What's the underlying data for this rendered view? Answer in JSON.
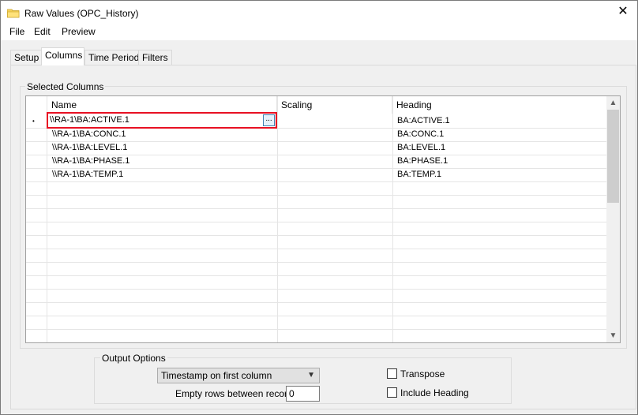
{
  "window": {
    "title": "Raw Values (OPC_History)"
  },
  "menu": {
    "items": [
      "File",
      "Edit",
      "Preview"
    ]
  },
  "tabs": [
    {
      "label": "Setup",
      "active": false
    },
    {
      "label": "Columns",
      "active": true
    },
    {
      "label": "Time Period",
      "active": false
    },
    {
      "label": "Filters",
      "active": false
    }
  ],
  "selected_columns": {
    "group_label": "Selected Columns",
    "headers": {
      "name": "Name",
      "scaling": "Scaling",
      "heading": "Heading"
    },
    "rows": [
      {
        "name": "\\\\RA-1\\BA:ACTIVE.1",
        "scaling": "",
        "heading": "BA:ACTIVE.1"
      },
      {
        "name": "\\\\RA-1\\BA:CONC.1",
        "scaling": "",
        "heading": "BA:CONC.1"
      },
      {
        "name": "\\\\RA-1\\BA:LEVEL.1",
        "scaling": "",
        "heading": "BA:LEVEL.1"
      },
      {
        "name": "\\\\RA-1\\BA:PHASE.1",
        "scaling": "",
        "heading": "BA:PHASE.1"
      },
      {
        "name": "\\\\RA-1\\BA:TEMP.1",
        "scaling": "",
        "heading": "BA:TEMP.1"
      }
    ],
    "editing_row_indicator": "•",
    "browse_button": "..."
  },
  "output_options": {
    "group_label": "Output Options",
    "timestamp_select": "Timestamp on first column",
    "empty_rows_label": "Empty rows between records",
    "empty_rows_value": "0",
    "transpose_label": "Transpose",
    "transpose_checked": false,
    "include_heading_label": "Include Heading",
    "include_heading_checked": false
  },
  "icons": {
    "window": "folder-icon",
    "close": "close-icon",
    "scroll_up": "chevron-up-icon",
    "scroll_down": "chevron-down-icon",
    "combo": "chevron-down-icon"
  },
  "colors": {
    "highlight": "#e81123",
    "background": "#f0f0f0"
  }
}
